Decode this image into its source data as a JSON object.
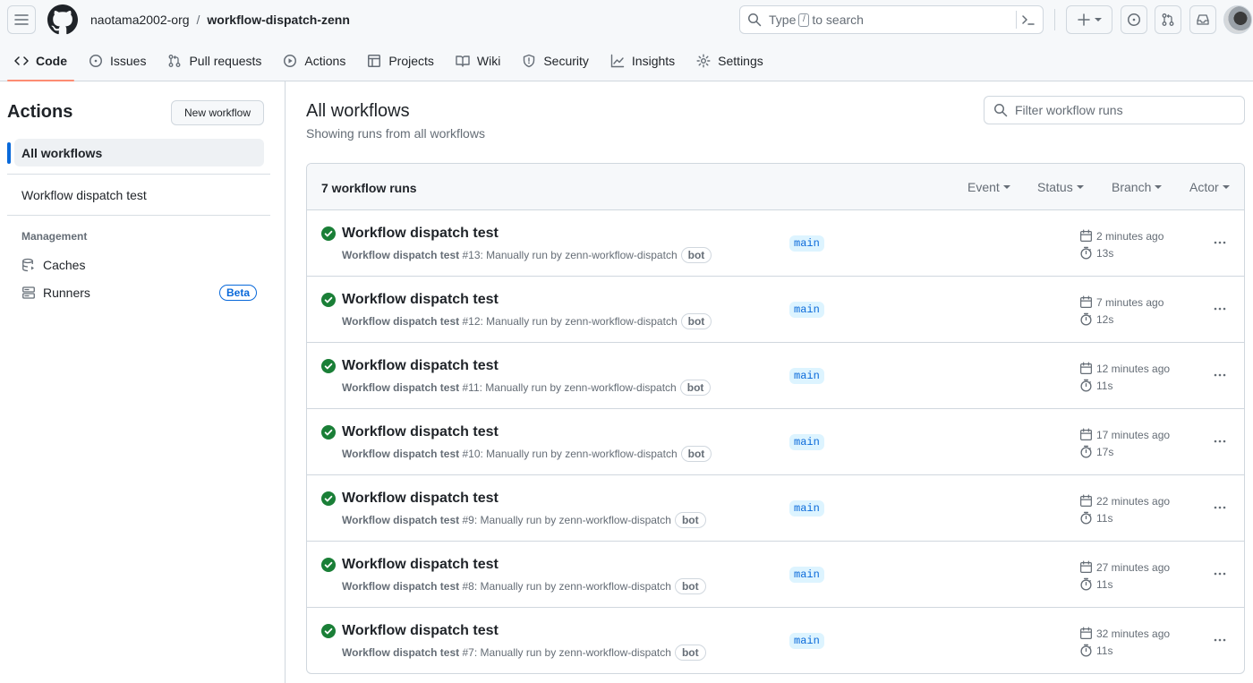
{
  "header": {
    "owner": "naotama2002-org",
    "separator": "/",
    "repo": "workflow-dispatch-zenn",
    "search_prefix": "Type",
    "search_key": "/",
    "search_suffix": "to search",
    "cmd_symbol": ">_",
    "plus_symbol": "+"
  },
  "tabs": [
    {
      "label": "Code",
      "icon": "code-icon"
    },
    {
      "label": "Issues",
      "icon": "issue-icon"
    },
    {
      "label": "Pull requests",
      "icon": "pull-request-icon"
    },
    {
      "label": "Actions",
      "icon": "play-icon"
    },
    {
      "label": "Projects",
      "icon": "table-icon"
    },
    {
      "label": "Wiki",
      "icon": "book-icon"
    },
    {
      "label": "Security",
      "icon": "shield-icon"
    },
    {
      "label": "Insights",
      "icon": "graph-icon"
    },
    {
      "label": "Settings",
      "icon": "gear-icon"
    }
  ],
  "sidebar": {
    "title": "Actions",
    "new_workflow": "New workflow",
    "items": [
      {
        "label": "All workflows"
      },
      {
        "label": "Workflow dispatch test"
      }
    ],
    "management_heading": "Management",
    "management": [
      {
        "label": "Caches",
        "icon": "database-icon"
      },
      {
        "label": "Runners",
        "icon": "server-icon"
      }
    ],
    "beta": "Beta"
  },
  "main": {
    "title": "All workflows",
    "subtitle": "Showing runs from all workflows",
    "filter_placeholder": "Filter workflow runs",
    "count": "7 workflow runs",
    "filters": [
      "Event",
      "Status",
      "Branch",
      "Actor"
    ]
  },
  "runs": [
    {
      "title": "Workflow dispatch test",
      "name": "Workflow dispatch test",
      "number": "#13",
      "trigger": ": Manually run by zenn-workflow-dispatch",
      "badge": "bot",
      "branch": "main",
      "time": "2 minutes ago",
      "duration": "13s"
    },
    {
      "title": "Workflow dispatch test",
      "name": "Workflow dispatch test",
      "number": "#12",
      "trigger": ": Manually run by zenn-workflow-dispatch",
      "badge": "bot",
      "branch": "main",
      "time": "7 minutes ago",
      "duration": "12s"
    },
    {
      "title": "Workflow dispatch test",
      "name": "Workflow dispatch test",
      "number": "#11",
      "trigger": ": Manually run by zenn-workflow-dispatch",
      "badge": "bot",
      "branch": "main",
      "time": "12 minutes ago",
      "duration": "11s"
    },
    {
      "title": "Workflow dispatch test",
      "name": "Workflow dispatch test",
      "number": "#10",
      "trigger": ": Manually run by zenn-workflow-dispatch",
      "badge": "bot",
      "branch": "main",
      "time": "17 minutes ago",
      "duration": "17s"
    },
    {
      "title": "Workflow dispatch test",
      "name": "Workflow dispatch test",
      "number": "#9",
      "trigger": ": Manually run by zenn-workflow-dispatch",
      "badge": "bot",
      "branch": "main",
      "time": "22 minutes ago",
      "duration": "11s"
    },
    {
      "title": "Workflow dispatch test",
      "name": "Workflow dispatch test",
      "number": "#8",
      "trigger": ": Manually run by zenn-workflow-dispatch",
      "badge": "bot",
      "branch": "main",
      "time": "27 minutes ago",
      "duration": "11s"
    },
    {
      "title": "Workflow dispatch test",
      "name": "Workflow dispatch test",
      "number": "#7",
      "trigger": ": Manually run by zenn-workflow-dispatch",
      "badge": "bot",
      "branch": "main",
      "time": "32 minutes ago",
      "duration": "11s"
    }
  ],
  "colors": {
    "success": "#1a7f37",
    "accent": "#0969da",
    "tab_underline": "#fd8c73",
    "branch_bg": "#ddf4ff"
  }
}
